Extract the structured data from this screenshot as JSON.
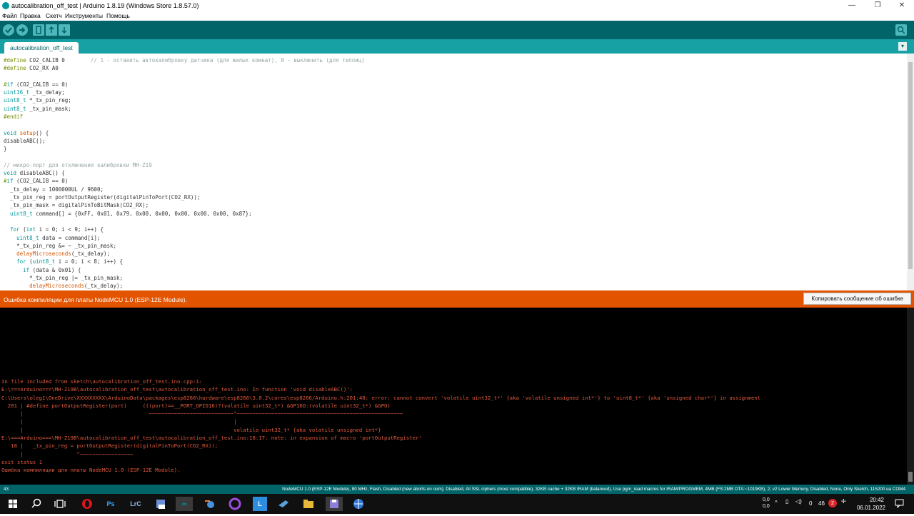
{
  "window": {
    "title": "autocalibration_off_test | Arduino 1.8.19 (Windows Store 1.8.57.0)",
    "controls": [
      "—",
      "❐",
      "✕"
    ]
  },
  "menu": [
    "Файл",
    "Правка",
    "Скетч",
    "Инструменты",
    "Помощь"
  ],
  "toolbar": {
    "buttons": [
      "verify-icon",
      "upload-icon",
      "new-icon",
      "open-icon",
      "save-icon"
    ],
    "serial_monitor": "serial-monitor-icon"
  },
  "tab": {
    "label": "autocalibration_off_test",
    "menu_glyph": "▾"
  },
  "code_lines": [
    "#define CO2_CALIB 0        // 1 - оставить автокалибровку датчика (для жилых комнат), 0 - выключить (для теплиц)",
    "#define CO2_RX A0",
    "",
    "#if (CO2_CALIB == 0)",
    "uint16_t _tx_delay;",
    "uint8_t *_tx_pin_reg;",
    "uint8_t _tx_pin_mask;",
    "#endif",
    "",
    "void setup() {",
    "disableABC();",
    "}",
    "",
    "// микро-порт для отключения калибровки MH-Z19",
    "void disableABC() {",
    "#if (CO2_CALIB == 0)",
    "  _tx_delay = 1000000UL / 9600;",
    "  _tx_pin_reg = portOutputRegister(digitalPinToPort(CO2_RX));",
    "  _tx_pin_mask = digitalPinToBitMask(CO2_RX);",
    "  uint8_t command[] = {0xFF, 0x01, 0x79, 0x00, 0x00, 0x00, 0x00, 0x00, 0x87};",
    "",
    "  for (int i = 0; i < 9; i++) {",
    "    uint8_t data = command[i];",
    "    *_tx_pin_reg &= ~ _tx_pin_mask;",
    "    delayMicroseconds(_tx_delay);",
    "    for (uint8_t i = 0; i < 8; i++) {",
    "      if (data & 0x01) {",
    "        *_tx_pin_reg |= _tx_pin_mask;",
    "        delayMicroseconds(_tx_delay);"
  ],
  "error_bar": {
    "message": "Ошибка компиляции для платы NodeMCU 1.0 (ESP-12E Module).",
    "copy_button": "Копировать сообщение об ошибке"
  },
  "console_lines": [
    "In file included from sketch\\autocalibration_off_test.ino.cpp:1:",
    "E:\\===Arduino===\\MH-Z19B\\autocalibration_off_test\\autocalibration_off_test.ino: In function 'void disableABC()':",
    "C:\\Users\\oleg1\\OneDrive\\XXXXXXXXX\\ArduinoData\\packages\\esp8266\\hardware\\esp8266\\3.0.2\\cores\\esp8266/Arduino.h:201:40: error: cannot convert 'volatile uint32_t*' {aka 'volatile unsigned int*'} to 'uint8_t*' {aka 'unsigned char*'} in assignment",
    "  201 | #define portOutputRegister(port)     (((port)==__PORT_GPIO16)?(volatile uint32_t*) &GP16O:(volatile uint32_t*) &GPO)",
    "      |                                        ~~~~~~~~~~~~~~~~~~~~~~~~~~~^~~~~~~~~~~~~~~~~~~~~~~~~~~~~~~~~~~~~~~~~~~~~~~~~~~~~~",
    "      |                                                                   |",
    "      |                                                                   volatile uint32_t* {aka volatile unsigned int*}",
    "E:\\===Arduino===\\MH-Z19B\\autocalibration_off_test\\autocalibration_off_test.ino:18:17: note: in expansion of macro 'portOutputRegister'",
    "   18 |   _tx_pin_reg = portOutputRegister(digitalPinToPort(CO2_RX));",
    "      |                 ^~~~~~~~~~~~~~~~~~",
    "exit status 1",
    "Ошибка компиляции для платы NodeMCU 1.0 (ESP-12E Module)."
  ],
  "status": {
    "line": "43",
    "board": "NodeMCU 1.0 (ESP-12E Module), 80 MHz, Flash, Disabled (new aborts on oom), Disabled, All SSL ciphers (most compatible), 32KB cache + 32KB IRAM (balanced), Use pgm_read macros for IRAM/PROGMEM, 4MB (FS:2MB OTA:~1019KB), 2, v2 Lower Memory, Disabled, None, Only Sketch, 115200 на COM4"
  },
  "taskbar": {
    "apps": [
      "windows-start-icon",
      "search-icon",
      "task-view-icon",
      "opera-icon",
      "photoshop-icon",
      "lightroom-icon",
      "app-icon",
      "arduino-icon",
      "blender-icon",
      "onenote-icon",
      "launcher-icon",
      "steam-icon",
      "folder-icon",
      "save-app-icon",
      "browser-icon"
    ],
    "app_labels": {
      "photoshop": "Ps",
      "lightroom": "LrC",
      "arduino": "∞",
      "launcher": "L"
    },
    "tray": {
      "net_top": "0,0",
      "net_bottom": "0,0",
      "count1": "0",
      "count2": "46",
      "badge": "2",
      "time": "20:42",
      "date": "06.01.2022"
    }
  },
  "colors": {
    "teal_dark": "#006468",
    "teal": "#17a1a5",
    "error_orange": "#e35400",
    "console_text": "#e25a3e"
  }
}
